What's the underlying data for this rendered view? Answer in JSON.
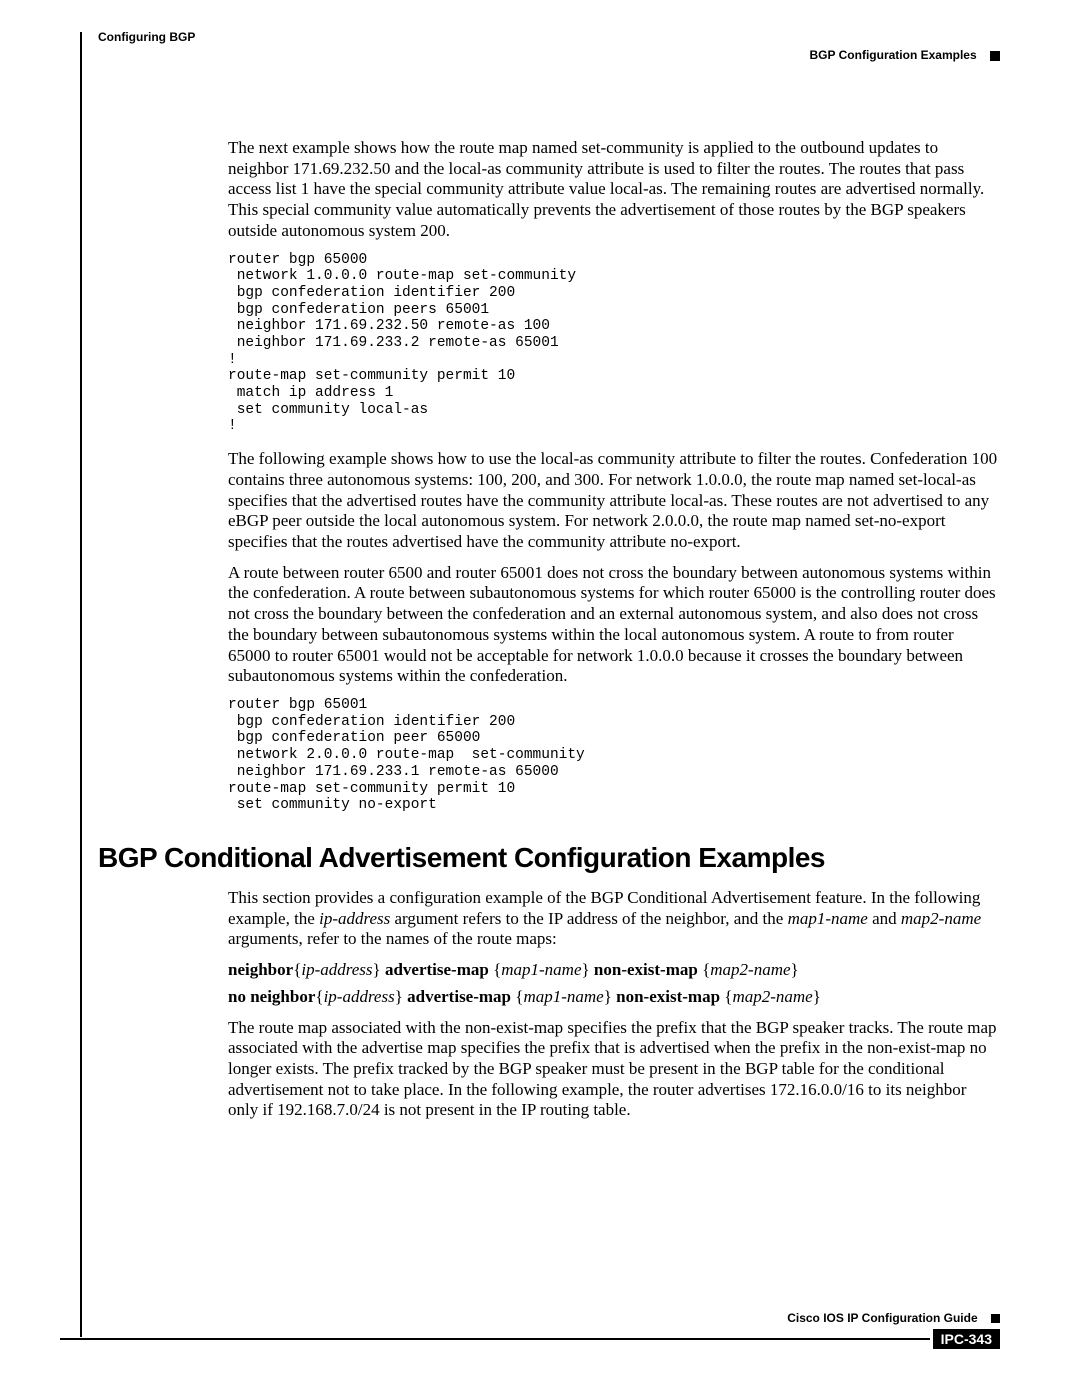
{
  "header": {
    "chapter": "Configuring BGP",
    "section": "BGP Configuration Examples"
  },
  "body": {
    "p1": "The next example shows how the route map named set-community is applied to the outbound updates to neighbor 171.69.232.50 and the local-as community attribute is used to filter the routes. The routes that pass access list 1 have the special community attribute value local-as. The remaining routes are advertised normally. This special community value automatically prevents the advertisement of those routes by the BGP speakers outside autonomous system 200.",
    "code1": "router bgp 65000\n network 1.0.0.0 route-map set-community\n bgp confederation identifier 200\n bgp confederation peers 65001\n neighbor 171.69.232.50 remote-as 100\n neighbor 171.69.233.2 remote-as 65001\n!\nroute-map set-community permit 10\n match ip address 1\n set community local-as\n!",
    "p2": "The following example shows how to use the local-as community attribute to filter the routes. Confederation 100 contains three autonomous systems: 100, 200, and 300. For network 1.0.0.0, the route map named set-local-as specifies that the advertised routes have the community attribute local-as. These routes are not advertised to any eBGP peer outside the local autonomous system. For network 2.0.0.0, the route map named set-no-export specifies that the routes advertised have the community attribute no-export.",
    "p3": "A route between router 6500 and router 65001 does not cross the boundary between autonomous systems within the confederation. A route between subautonomous systems for which router 65000 is the controlling router does not cross the boundary between the confederation and an external autonomous system, and also does not cross the boundary between subautonomous systems within the local autonomous system. A route to from router 65000 to router 65001 would not be acceptable for network 1.0.0.0 because it crosses the boundary between subautonomous systems within the confederation.",
    "code2": "router bgp 65001\n bgp confederation identifier 200\n bgp confederation peer 65000\n network 2.0.0.0 route-map  set-community\n neighbor 171.69.233.1 remote-as 65000\nroute-map set-community permit 10\n set community no-export"
  },
  "section2": {
    "title": "BGP Conditional Advertisement Configuration Examples",
    "intro_pre": "This section provides a configuration example of the BGP Conditional Advertisement feature. In the following example, the ",
    "intro_arg1": "ip-address",
    "intro_mid1": " argument refers to the IP address of the neighbor, and the ",
    "intro_arg2": "map1-name",
    "intro_mid2": " and ",
    "intro_arg3": "map2-name",
    "intro_post": " arguments, refer to the names of the route maps:",
    "syntax1": {
      "t1": "neighbor",
      "brace_o1": "{",
      "a1": "ip-address",
      "brace_c1": "}",
      "t2": " advertise-map ",
      "brace_o2": "{",
      "a2": "map1-name",
      "brace_c2": "}",
      "t3": " non-exist-map ",
      "brace_o3": "{",
      "a3": "map2-name",
      "brace_c3": "}"
    },
    "syntax2": {
      "t1": "no neighbor",
      "brace_o1": "{",
      "a1": "ip-address",
      "brace_c1": "}",
      "t2": " advertise-map ",
      "brace_o2": "{",
      "a2": "map1-name",
      "brace_c2": "}",
      "t3": " non-exist-map ",
      "brace_o3": "{",
      "a3": "map2-name",
      "brace_c3": "}"
    },
    "p_after": "The route map associated with the non-exist-map specifies the prefix that the BGP speaker tracks. The route map associated with the advertise map specifies the prefix that is advertised when the prefix in the non-exist-map no longer exists. The prefix tracked by the BGP speaker must be present in the BGP table for the conditional advertisement not to take place. In the following example, the router advertises 172.16.0.0/16 to its neighbor only if 192.168.7.0/24 is not present in the IP routing table."
  },
  "footer": {
    "guide": "Cisco IOS IP Configuration Guide",
    "page": "IPC-343"
  }
}
